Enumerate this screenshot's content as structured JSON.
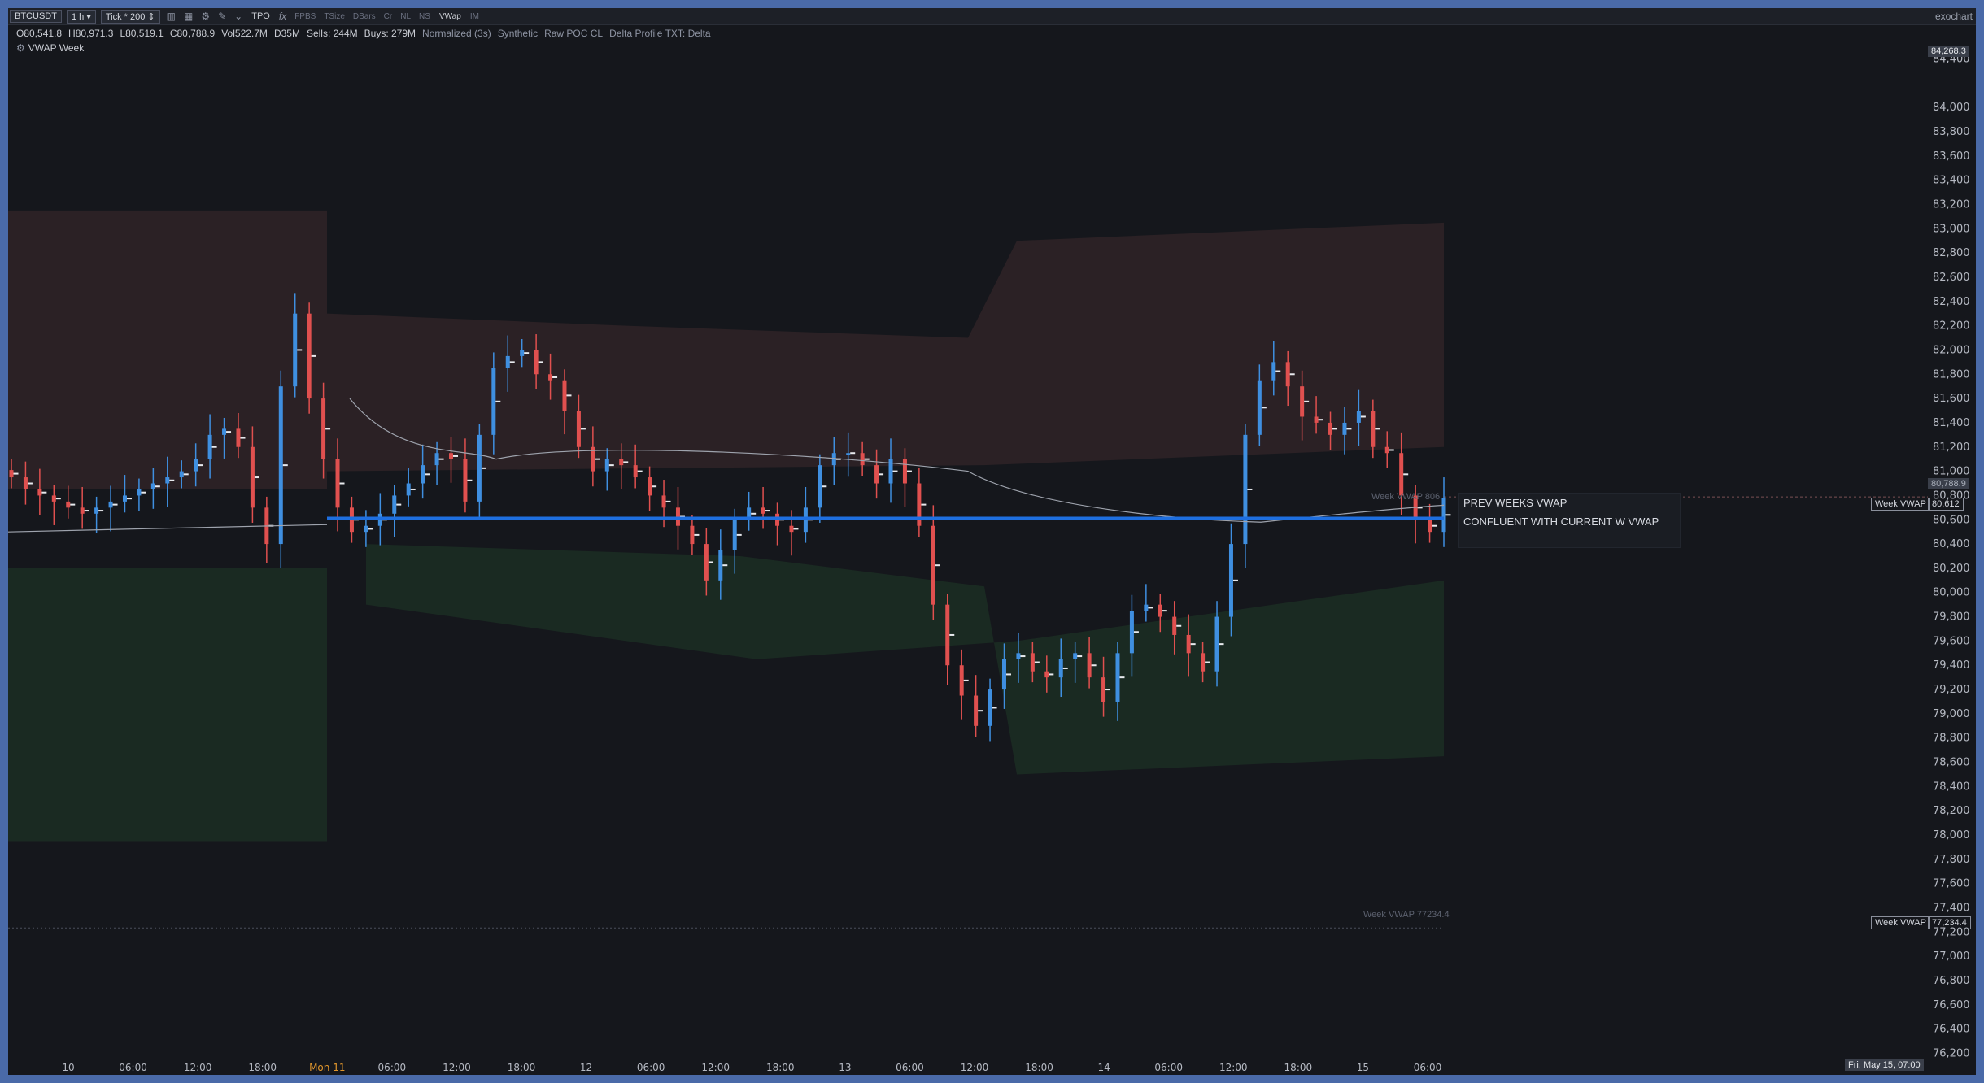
{
  "toolbar": {
    "symbol": "BTCUSDT",
    "timeframe": "1 h",
    "tick": "Tick * 200",
    "tpo": "TPO",
    "fx": "fx",
    "tools": [
      "FPBS",
      "TSize",
      "DBars",
      "Cr",
      "NL",
      "NS",
      "VWap",
      "IM"
    ],
    "brand": "exochart"
  },
  "info_bar": {
    "open": "O80,541.8",
    "high": "H80,971.3",
    "low": "L80,519.1",
    "close": "C80,788.9",
    "volume": "Vol522.7M",
    "delta": "D35M",
    "sells": "Sells: 244M",
    "buys": "Buys: 279M",
    "mode": "Normalized (3s)",
    "synthetic": "Synthetic",
    "raw": "Raw POC CL",
    "profile": "Delta Profile TXT: Delta"
  },
  "indicator_label": "VWAP Week",
  "annotation": {
    "line1": "PREV WEEKS VWAP",
    "line2": "CONFLUENT WITH CURRENT W VWAP"
  },
  "right_tags": {
    "current_price": "80,788.9",
    "top_price": "84,268.3",
    "vwap_name": "Week VWAP",
    "vwap_value": "80,612",
    "prev_vwap_value": "77,234.4",
    "prev_vwap_chart_label": "Week VWAP 77234.4",
    "vwap_chart_label": "Week VWAP 806",
    "date_label": "Fri, May 15, 07:00"
  },
  "colors": {
    "background": "#15171c",
    "up_candle": "#3f8fe0",
    "down_candle": "#e0504f",
    "vwap_line": "#1e6fe0",
    "upper_band": "#2b2125",
    "lower_band": "#1a2a22",
    "vwap_curve": "#9ea3ad"
  },
  "chart_data": {
    "type": "candlestick",
    "x_ticks": [
      "10",
      "06:00",
      "12:00",
      "18:00",
      "Mon 11",
      "06:00",
      "12:00",
      "18:00",
      "12",
      "06:00",
      "12:00",
      "18:00",
      "13",
      "06:00",
      "12:00",
      "18:00",
      "14",
      "06:00",
      "12:00",
      "18:00",
      "15",
      "06:00"
    ],
    "y_ticks": [
      84400,
      84000,
      83800,
      83600,
      83400,
      83200,
      83000,
      82800,
      82600,
      82400,
      82200,
      82000,
      81800,
      81600,
      81400,
      81200,
      81000,
      80800,
      80600,
      80400,
      80200,
      80000,
      79800,
      79600,
      79400,
      79200,
      79000,
      78800,
      78600,
      78400,
      78200,
      78000,
      77800,
      77600,
      77400,
      77200,
      77000,
      76800,
      76600,
      76400,
      76200
    ],
    "y_tick_labels": [
      "84,400",
      "84,000",
      "83,800",
      "83,600",
      "83,400",
      "83,200",
      "83,000",
      "82,800",
      "82,600",
      "82,400",
      "82,200",
      "82,000",
      "81,800",
      "81,600",
      "81,400",
      "81,200",
      "81,000",
      "80,800",
      "80,600",
      "80,400",
      "80,200",
      "80,000",
      "79,800",
      "79,600",
      "79,400",
      "79,200",
      "79,000",
      "78,800",
      "78,600",
      "78,400",
      "78,200",
      "78,000",
      "77,800",
      "77,600",
      "77,400",
      "77,200",
      "77,000",
      "76,800",
      "76,600",
      "76,400",
      "76,200"
    ],
    "ylim": [
      76150,
      84450
    ],
    "close_series": [
      80950,
      80850,
      80800,
      80750,
      80700,
      80650,
      80700,
      80750,
      80800,
      80850,
      80900,
      80950,
      81000,
      81100,
      81300,
      81350,
      81200,
      80700,
      80400,
      81700,
      82300,
      81600,
      81100,
      80700,
      80500,
      80550,
      80650,
      80800,
      80900,
      81050,
      81150,
      81100,
      80750,
      81300,
      81850,
      81950,
      82000,
      81800,
      81750,
      81500,
      81200,
      81000,
      81100,
      81050,
      80950,
      80800,
      80700,
      80550,
      80400,
      80100,
      80350,
      80600,
      80700,
      80650,
      80550,
      80500,
      80700,
      81050,
      81150,
      81150,
      81050,
      80900,
      81100,
      80900,
      80550,
      79900,
      79400,
      79150,
      78900,
      79200,
      79450,
      79500,
      79350,
      79300,
      79450,
      79500,
      79300,
      79100,
      79500,
      79850,
      79900,
      79800,
      79650,
      79500,
      79350,
      79800,
      80400,
      81300,
      81750,
      81900,
      81700,
      81450,
      81400,
      81300,
      81400,
      81500,
      81200,
      81150,
      80800,
      80600,
      80500,
      80780
    ],
    "week_vwap": 80612,
    "prev_week_vwap": 77234.4,
    "current_price": 80788.9
  }
}
